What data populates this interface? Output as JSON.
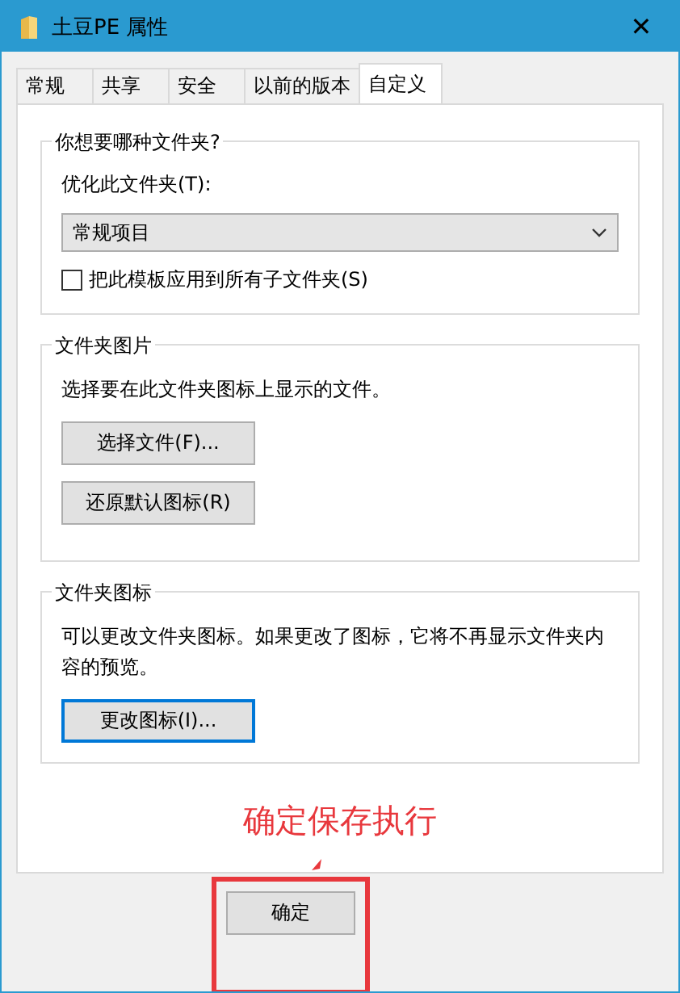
{
  "window": {
    "title": "土豆PE 属性",
    "close": "✕"
  },
  "tabs": [
    {
      "label": "常规",
      "selected": false
    },
    {
      "label": "共享",
      "selected": false
    },
    {
      "label": "安全",
      "selected": false
    },
    {
      "label": "以前的版本",
      "selected": false
    },
    {
      "label": "自定义",
      "selected": true
    }
  ],
  "optimize_group": {
    "title": "你想要哪种文件夹?",
    "label": "优化此文件夹(T):",
    "dropdown_value": "常规项目",
    "checkbox": {
      "label": "把此模板应用到所有子文件夹(S)",
      "checked": false
    }
  },
  "picture_group": {
    "title": "文件夹图片",
    "description": "选择要在此文件夹图标上显示的文件。",
    "buttons": [
      "选择文件(F)...",
      "还原默认图标(R)"
    ]
  },
  "icon_group": {
    "title": "文件夹图标",
    "description": "可以更改文件夹图标。如果更改了图标，它将不再显示文件夹内容的预览。",
    "button": "更改图标(I)..."
  },
  "annotation": {
    "text": "确定保存执行"
  },
  "footer_buttons": [
    "确定"
  ]
}
